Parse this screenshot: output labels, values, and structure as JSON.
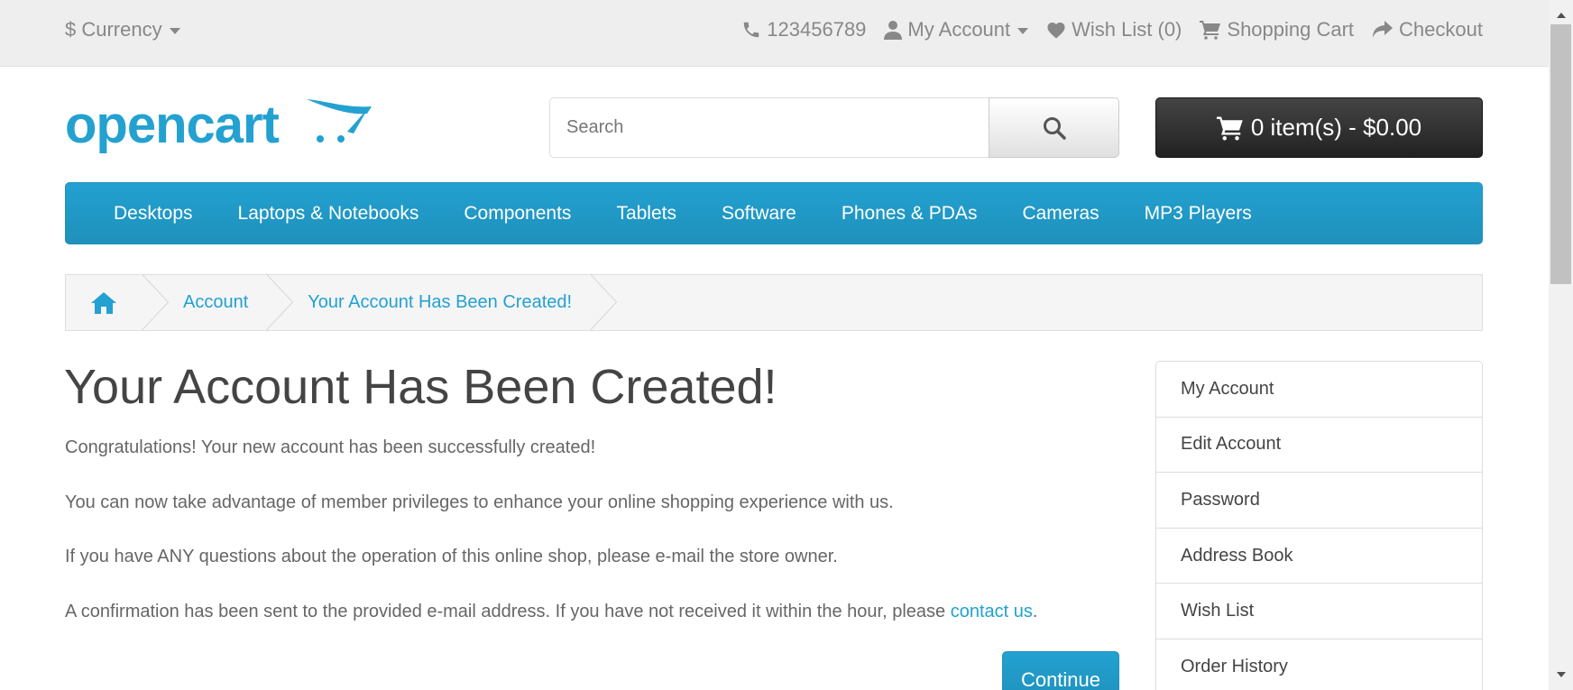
{
  "topbar": {
    "currency_label": "$ Currency",
    "phone": "123456789",
    "my_account": "My Account",
    "wish_list": "Wish List (0)",
    "shopping_cart": "Shopping Cart",
    "checkout": "Checkout"
  },
  "header": {
    "logo_text": "opencart",
    "search_placeholder": "Search",
    "cart_label": "0 item(s) - $0.00"
  },
  "menu": {
    "items": [
      "Desktops",
      "Laptops & Notebooks",
      "Components",
      "Tablets",
      "Software",
      "Phones & PDAs",
      "Cameras",
      "MP3 Players"
    ]
  },
  "breadcrumb": {
    "items": [
      "Account",
      "Your Account Has Been Created!"
    ]
  },
  "content": {
    "title": "Your Account Has Been Created!",
    "p1": "Congratulations! Your new account has been successfully created!",
    "p2": "You can now take advantage of member privileges to enhance your online shopping experience with us.",
    "p3": "If you have ANY questions about the operation of this online shop, please e-mail the store owner.",
    "p4_prefix": "A confirmation has been sent to the provided e-mail address. If you have not received it within the hour, please ",
    "p4_link": "contact us",
    "p4_suffix": ".",
    "continue_label": "Continue"
  },
  "sidebar": {
    "items": [
      "My Account",
      "Edit Account",
      "Password",
      "Address Book",
      "Wish List",
      "Order History"
    ]
  },
  "colors": {
    "accent": "#23a1d1",
    "cart_button": "#333333",
    "topbar_bg": "#eeeeee"
  }
}
